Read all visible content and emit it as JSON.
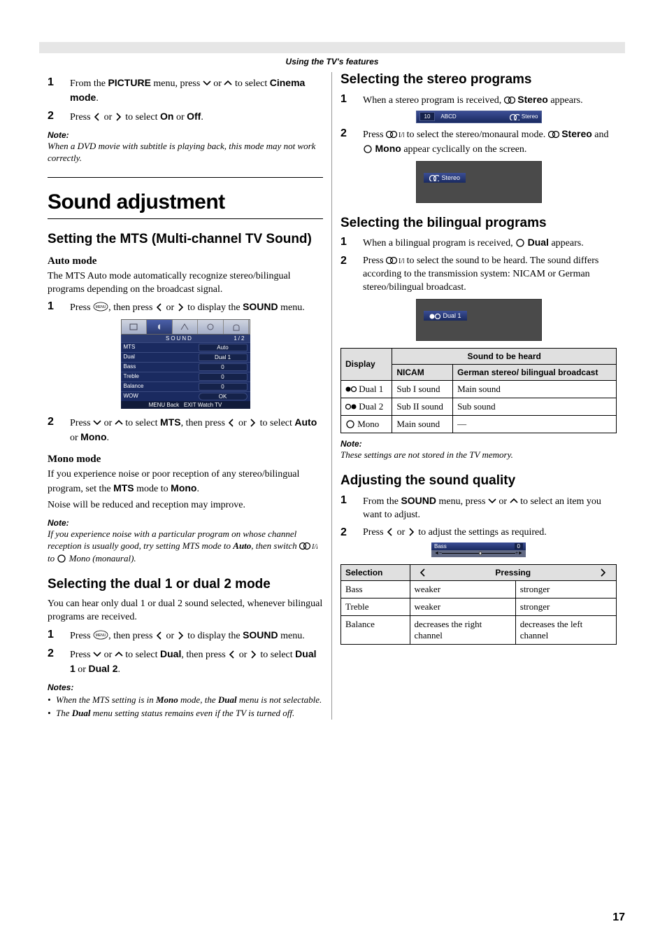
{
  "chapter": "Using the TV's features",
  "page_num": "17",
  "left": {
    "s1_pre": "From the ",
    "s1_menu": "PICTURE",
    "s1_mid": " menu, press ",
    "s1_post": " to select ",
    "s1_target": "Cinema mode",
    "s1_end": ".",
    "s2_pre": "Press ",
    "s2_mid": " to select ",
    "s2_on": "On",
    "s2_or": " or ",
    "s2_off": "Off",
    "s2_end": ".",
    "note1_h": "Note:",
    "note1_b": "When a DVD movie with subtitle is playing back, this mode may not work correctly.",
    "h1": "Sound adjustment",
    "h2a": "Setting the MTS (Multi-channel TV Sound)",
    "h3a": "Auto mode",
    "p_auto": "The MTS Auto mode automatically recognize stereo/bilingual programs depending on the broadcast signal.",
    "s3_pre": "Press ",
    "s3_mid": ", then press ",
    "s3_post": " to display the ",
    "s3_menu": "SOUND",
    "s3_end": " menu.",
    "osd": {
      "title": "SOUND",
      "pg": "1/2",
      "rows": [
        {
          "l": "MTS",
          "v": "Auto"
        },
        {
          "l": "Dual",
          "v": "Dual 1"
        },
        {
          "l": "Bass",
          "v": "0"
        },
        {
          "l": "Treble",
          "v": "0"
        },
        {
          "l": "Balance",
          "v": "0"
        },
        {
          "l": "WOW",
          "v": "OK"
        }
      ],
      "ft_back": "MENU Back",
      "ft_exit": "EXIT Watch TV"
    },
    "s4_pre": "Press ",
    "s4_mid": " to select ",
    "s4_mts": "MTS",
    "s4_then": ", then press ",
    "s4_sel": " to select ",
    "s4_auto": "Auto",
    "s4_or": " or ",
    "s4_mono": "Mono",
    "s4_end": ".",
    "h3b": "Mono mode",
    "p_mono1": "If you experience noise or poor reception of any stereo/bilingual program, set the ",
    "p_mono_mts": "MTS",
    "p_mono2": " mode to ",
    "p_mono_mono": "Mono",
    "p_mono3": ".",
    "p_mono4": "Noise will be reduced and reception may improve.",
    "note2_h": "Note:",
    "note2_a": "If you experience noise with a particular program on whose channel reception is usually good, try setting MTS mode to ",
    "note2_auto": "Auto",
    "note2_b": ", then switch ",
    "note2_c": " to ",
    "note2_d": " Mono (monaural).",
    "h2b": "Selecting the dual 1 or dual 2 mode",
    "p_dual": "You can hear only dual 1 or dual 2 sound selected, whenever bilingual programs are received.",
    "s5_pre": "Press ",
    "s5_mid": ", then press ",
    "s5_post": " to display the ",
    "s5_menu": "SOUND",
    "s5_end": " menu.",
    "s6_pre": "Press ",
    "s6_mid": " to select ",
    "s6_dual": "Dual",
    "s6_then": ", then press ",
    "s6_sel": " to select ",
    "s6_d1": "Dual 1",
    "s6_or": " or ",
    "s6_d2": "Dual 2",
    "s6_end": ".",
    "notes_h": "Notes:",
    "notes_1a": "When the MTS setting is in ",
    "notes_1m": "Mono",
    "notes_1b": " mode, the ",
    "notes_1d": "Dual",
    "notes_1c": " menu is not selectable.",
    "notes_2a": "The ",
    "notes_2d": "Dual",
    "notes_2b": " menu setting status remains even if the TV is turned off."
  },
  "right": {
    "h2a": "Selecting the stereo programs",
    "s1_pre": "When a stereo program is received, ",
    "s1_ster": "Stereo",
    "s1_end": " appears.",
    "banner_ch": "10",
    "banner_name": "ABCD",
    "banner_mode": "Stereo",
    "s2_pre": "Press ",
    "s2_mid": " to select the stereo/monaural mode. ",
    "s2_ster": "Stereo",
    "s2_and": " and ",
    "s2_mono": "Mono",
    "s2_end": " appear cyclically on the screen.",
    "mini1": "Stereo",
    "h2b": "Selecting the bilingual programs",
    "s3_pre": "When a bilingual program is received, ",
    "s3_dual": "Dual",
    "s3_end": " appears.",
    "s4_pre": "Press ",
    "s4_mid": " to select the sound to be heard. The sound differs according to the transmission system: NICAM or German stereo/bilingual broadcast.",
    "mini2": "Dual  1",
    "t1": {
      "h_disp": "Display",
      "h_sth": "Sound to be heard",
      "h_nic": "NICAM",
      "h_ger": "German stereo/ bilingual broadcast",
      "r1": {
        "d": "Dual 1",
        "n": "Sub I sound",
        "g": "Main sound"
      },
      "r2": {
        "d": "Dual 2",
        "n": "Sub II sound",
        "g": "Sub sound"
      },
      "r3": {
        "d": "Mono",
        "n": "Main sound",
        "g": "—"
      }
    },
    "note_h": "Note:",
    "note_b": "These settings are not stored in the TV memory.",
    "h2c": "Adjusting the sound quality",
    "s5_pre": "From the ",
    "s5_menu": "SOUND",
    "s5_mid": " menu, press ",
    "s5_post": " to select an item you want to adjust.",
    "s6_pre": "Press ",
    "s6_end": " to adjust the settings as required.",
    "slider": {
      "label": "Bass",
      "val": "0"
    },
    "t2": {
      "h_sel": "Selection",
      "h_press": "Pressing",
      "r1": {
        "s": "Bass",
        "l": "weaker",
        "r": "stronger"
      },
      "r2": {
        "s": "Treble",
        "l": "weaker",
        "r": "stronger"
      },
      "r3": {
        "s": "Balance",
        "l": "decreases the right channel",
        "r": "decreases the left channel"
      }
    }
  }
}
